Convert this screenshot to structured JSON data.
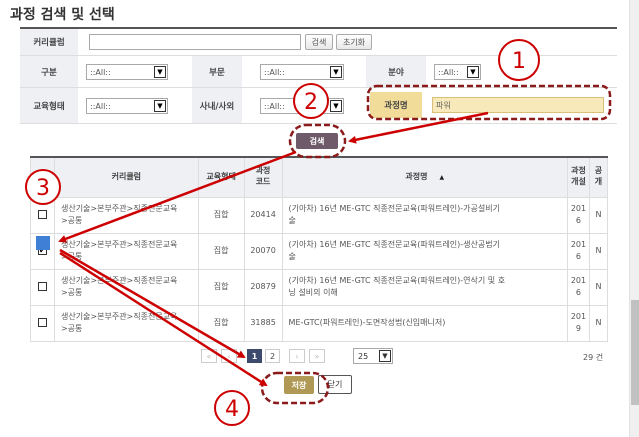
{
  "page": {
    "title": "과정 검색 및 선택"
  },
  "form": {
    "curriculum_label": "커리큘럼",
    "curriculum_value": "",
    "search_small_label": "검색",
    "reset_label": "초기화",
    "category_label": "구분",
    "category_value": "::All::",
    "department_label": "부문",
    "department_value": "::All::",
    "field_label": "분야",
    "field_value": "::All::",
    "edu_type_label": "교육형태",
    "edu_type_value": "::All::",
    "inout_label": "사내/사외",
    "inout_value": "::All::",
    "course_name_label": "과정명",
    "course_name_value": "파워",
    "search_button_label": "검색"
  },
  "table": {
    "headers": {
      "curriculum": "커리큘럼",
      "edu_type": "교육형태",
      "code": "과정\n코드",
      "course_name": "과정명",
      "opening": "과정\n개설",
      "public": "공\n개"
    },
    "sort_mark": "▲",
    "rows": [
      {
        "checked": false,
        "curriculum": "생산기술>본부주관>직종전문교육\n>공통",
        "edu_type": "집합",
        "code": "20414",
        "name": "(기아차) 16년 ME-GTC 직종전문교육(파워트레인)-가공설비기\n술",
        "opening": "201\n6",
        "public": "N"
      },
      {
        "checked": true,
        "curriculum": "생산기술>본부주관>직종전문교육\n>공통",
        "edu_type": "집합",
        "code": "20070",
        "name": "(기아차) 16년 ME-GTC 직종전문교육(파워트레인)-생산공법기\n술",
        "opening": "201\n6",
        "public": "N"
      },
      {
        "checked": false,
        "curriculum": "생산기술>본부주관>직종전문교육\n>공통",
        "edu_type": "집합",
        "code": "20879",
        "name": "(기아차) 16년 ME-GTC 직종전문교육(파워트레인)-연삭기 및 호\n닝 설비의 이해",
        "opening": "201\n6",
        "public": "N"
      },
      {
        "checked": false,
        "curriculum": "생산기술>본부주관>직종전문교육\n>공통",
        "edu_type": "집합",
        "code": "31885",
        "name": "ME-GTC(파워트레인)-도면작성법(신입매니저)",
        "opening": "201\n9",
        "public": "N"
      }
    ]
  },
  "pagination": {
    "first": "«",
    "prev": "‹",
    "pages": [
      "1",
      "2"
    ],
    "next": "›",
    "last": "»",
    "page_size": "25",
    "total": "29 건"
  },
  "buttons": {
    "save": "저장",
    "close": "닫기"
  },
  "annotations": {
    "markers": [
      "1",
      "2",
      "3",
      "4"
    ],
    "color": "#cc0000",
    "highlight_fill": "#f2dc9a",
    "highlight_border": "#8b1a1a"
  }
}
